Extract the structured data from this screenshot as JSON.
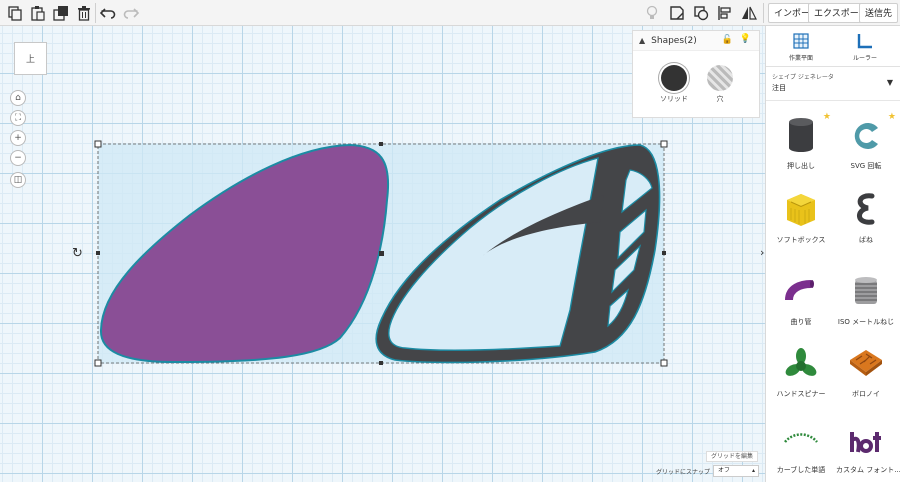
{
  "toolbar": {
    "left_icons": [
      "copy-icon",
      "paste-icon",
      "duplicate-icon",
      "delete-icon",
      "undo-icon",
      "redo-icon"
    ],
    "right_icons": [
      "light-bulb-icon",
      "note-icon",
      "workplane-shape-icon",
      "align-icon",
      "mirror-icon"
    ],
    "import_label": "インポート",
    "export_label": "エクスポート",
    "send_label": "送信先"
  },
  "viewcube": {
    "label": "上"
  },
  "nav": {
    "icons": [
      "home-view-icon",
      "fit-view-icon",
      "zoom-in-icon",
      "zoom-out-icon",
      "ortho-view-icon"
    ]
  },
  "inspector": {
    "title": "Shapes(2)",
    "solid_label": "ソリッド",
    "hole_label": "穴"
  },
  "grid": {
    "edit_label": "グリッドを編集",
    "snap_label": "グリッドにスナップ",
    "snap_value": "オフ"
  },
  "sidebar": {
    "workplane_label": "作業平面",
    "ruler_label": "ルーラー",
    "lib_caption": "シェイプ ジェネレータ",
    "lib_value": "注目",
    "shapes": [
      {
        "label": "押し出し",
        "icon": "extrusion-icon",
        "starred": true
      },
      {
        "label": "SVG 回転",
        "icon": "svg-revolve-icon",
        "starred": true
      },
      {
        "label": "ソフトボックス",
        "icon": "soft-box-icon",
        "starred": false
      },
      {
        "label": "ばね",
        "icon": "spring-icon",
        "starred": false
      },
      {
        "label": "曲り管",
        "icon": "bent-pipe-icon",
        "starred": false
      },
      {
        "label": "ISO メートルねじ",
        "icon": "iso-metric-thread-icon",
        "starred": false
      },
      {
        "label": "ハンドスピナー",
        "icon": "hand-spinner-icon",
        "starred": false
      },
      {
        "label": "ボロノイ",
        "icon": "voronoi-icon",
        "starred": false
      },
      {
        "label": "カーブした単語",
        "icon": "curved-word-icon",
        "starred": false
      },
      {
        "label": "カスタム フォント...",
        "icon": "custom-font-icon",
        "starred": false
      }
    ]
  },
  "colors": {
    "purple_shape": "#8a4f96",
    "dark_shape": "#444548",
    "selection_fill": "#cfe8f5",
    "shape_outline": "#1c8ba3"
  }
}
